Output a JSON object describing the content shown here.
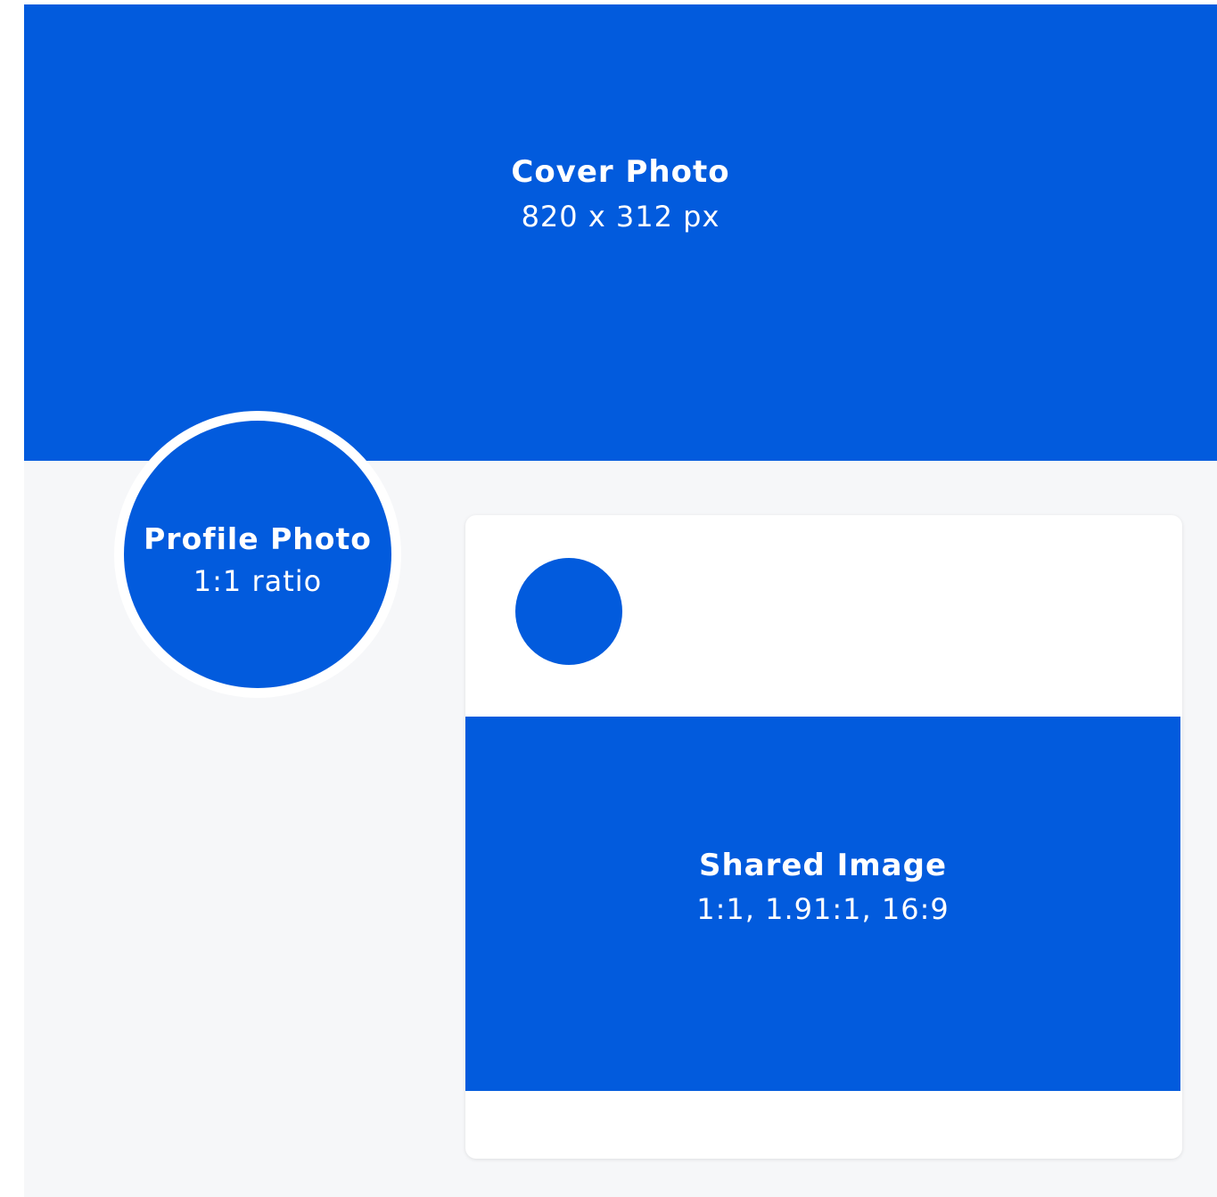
{
  "colors": {
    "brand_blue": "#025bdd",
    "background": "#f6f7f9",
    "card": "#ffffff"
  },
  "cover": {
    "title": "Cover Photo",
    "subtitle": "820 x 312 px"
  },
  "profile": {
    "title": "Profile Photo",
    "subtitle": "1:1 ratio"
  },
  "shared_image": {
    "title": "Shared Image",
    "subtitle": "1:1, 1.91:1, 16:9"
  }
}
